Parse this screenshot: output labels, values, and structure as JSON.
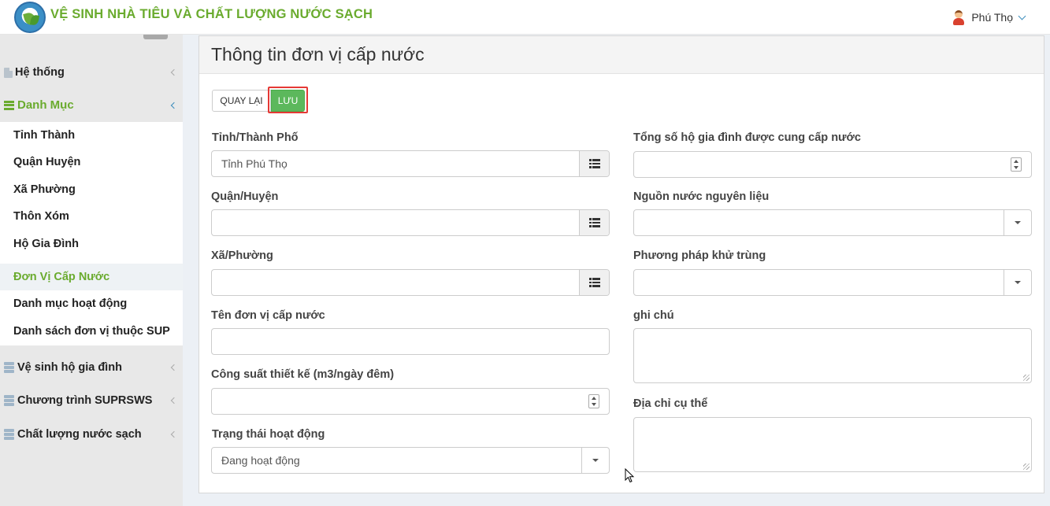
{
  "header": {
    "app_title": "VỆ SINH NHÀ TIÊU VÀ CHẤT LƯỢNG NƯỚC SẠCH",
    "user_name": "Phú Thọ"
  },
  "sidebar": {
    "items": [
      {
        "label": "Hệ thống",
        "icon": "file-icon"
      },
      {
        "label": "Danh Mục",
        "icon": "bars-icon",
        "expanded": true
      },
      {
        "label": "Vệ sinh hộ gia đình",
        "icon": "database-icon"
      },
      {
        "label": "Chương trình SUPRSWS",
        "icon": "database-icon"
      },
      {
        "label": "Chất lượng nước sạch",
        "icon": "database-icon"
      }
    ],
    "submenu": [
      {
        "label": "Tỉnh Thành"
      },
      {
        "label": "Quận Huyện"
      },
      {
        "label": "Xã Phường"
      },
      {
        "label": "Thôn Xóm"
      },
      {
        "label": "Hộ Gia Đình"
      },
      {
        "label": "Đơn Vị Cấp Nước",
        "active": true
      },
      {
        "label": "Danh mục hoạt động"
      },
      {
        "label": "Danh sách đơn vị thuộc SUP"
      }
    ]
  },
  "main": {
    "title": "Thông tin đơn vị cấp nước",
    "back_label": "QUAY LẠI",
    "save_label": "LƯU",
    "fields": {
      "province": {
        "label": "Tỉnh/Thành Phố",
        "value": "Tỉnh Phú Thọ"
      },
      "district": {
        "label": "Quận/Huyện",
        "value": ""
      },
      "ward": {
        "label": "Xã/Phường",
        "value": ""
      },
      "unit_name": {
        "label": "Tên đơn vị cấp nước",
        "value": ""
      },
      "capacity": {
        "label": "Công suất thiết kế (m3/ngày đêm)",
        "value": ""
      },
      "status": {
        "label": "Trạng thái hoạt động",
        "value": "Đang hoạt động"
      },
      "households": {
        "label": "Tổng số hộ gia đình được cung cấp nước",
        "value": ""
      },
      "water_source": {
        "label": "Nguồn nước nguyên liệu",
        "value": ""
      },
      "disinfection": {
        "label": "Phương pháp khử trùng",
        "value": ""
      },
      "note": {
        "label": "ghi chú",
        "value": ""
      },
      "address": {
        "label": "Địa chỉ cụ thể",
        "value": ""
      }
    }
  },
  "colors": {
    "brand_green": "#6aab2e",
    "save_green": "#5cb85c",
    "highlight_red": "#e53935",
    "accent_blue": "#3c8dbc"
  }
}
